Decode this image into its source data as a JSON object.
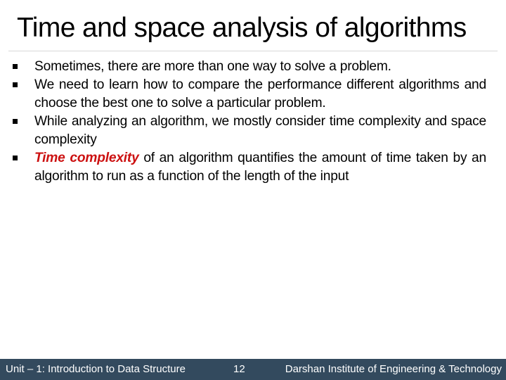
{
  "slide": {
    "title": "Time and space analysis of algorithms",
    "bullets": [
      {
        "text": "Sometimes, there are more than one way to solve a problem."
      },
      {
        "text": "We need to learn how to compare the performance different algorithms and choose the best one to solve a particular problem."
      },
      {
        "text": "While analyzing an algorithm, we mostly consider time complexity and space complexity"
      },
      {
        "emphasis": "Time complexity",
        "text": " of an algorithm quantifies the amount of time taken by an algorithm to run as a function of the length of the input"
      }
    ],
    "bullet_icon": "square-bullet-icon",
    "emphasis_color": "#cc1111"
  },
  "footer": {
    "unit": "Unit – 1: Introduction to Data Structure",
    "page_number": "12",
    "institute": "Darshan Institute of Engineering & Technology",
    "background_color": "#334a5e"
  }
}
